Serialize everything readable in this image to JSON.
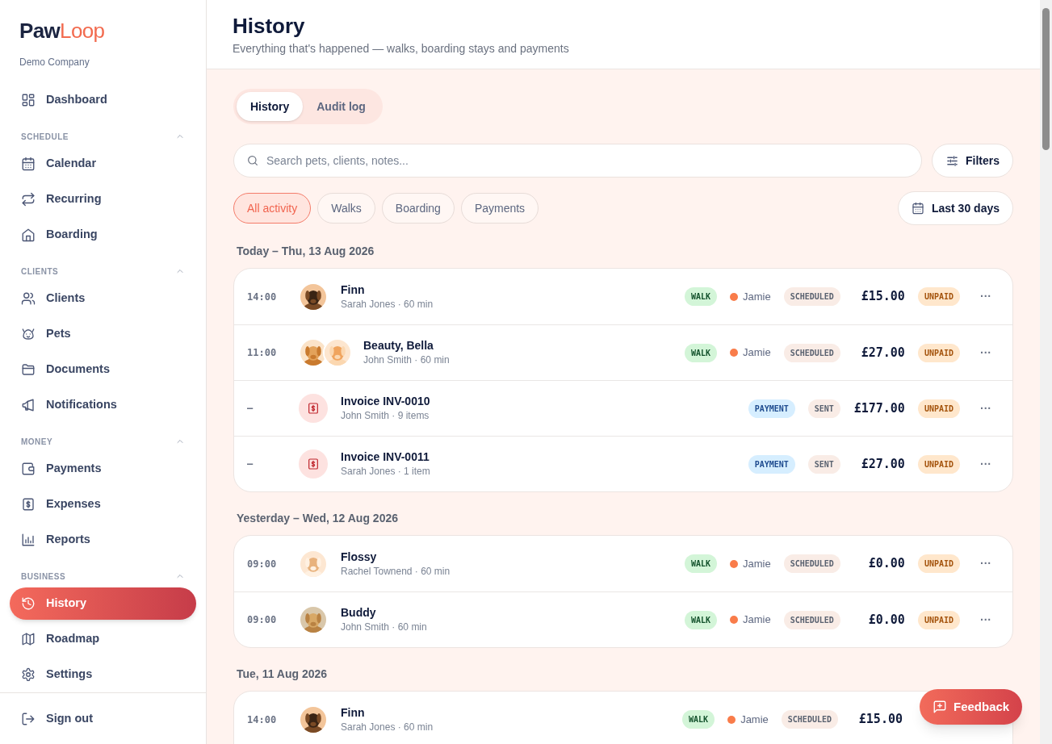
{
  "sidebar": {
    "logo": {
      "lead": "Paw",
      "accent": "Loop"
    },
    "company": "Demo Company",
    "sections": [
      {
        "items": [
          {
            "label": "Dashboard",
            "selected": false
          }
        ]
      },
      {
        "title": "SCHEDULE",
        "expanded": true,
        "items": [
          {
            "label": "Calendar",
            "selected": false
          },
          {
            "label": "Recurring",
            "selected": false
          },
          {
            "label": "Boarding",
            "selected": false
          }
        ]
      },
      {
        "title": "CLIENTS",
        "expanded": true,
        "items": [
          {
            "label": "Clients",
            "selected": false
          },
          {
            "label": "Pets",
            "selected": false
          },
          {
            "label": "Documents",
            "selected": false
          },
          {
            "label": "Notifications",
            "selected": false
          }
        ]
      },
      {
        "title": "MONEY",
        "expanded": true,
        "items": [
          {
            "label": "Payments",
            "selected": false
          },
          {
            "label": "Expenses",
            "selected": false
          },
          {
            "label": "Reports",
            "selected": false
          }
        ]
      },
      {
        "title": "BUSINESS",
        "expanded": true,
        "items": [
          {
            "label": "History",
            "selected": true
          },
          {
            "label": "Roadmap",
            "selected": false
          },
          {
            "label": "Settings",
            "selected": false
          }
        ]
      }
    ],
    "sign_out": "Sign out"
  },
  "header": {
    "title": "History",
    "subtitle": "Everything that's happened — walks, boarding stays and payments"
  },
  "tabs": [
    {
      "label": "History",
      "selected": true
    },
    {
      "label": "Audit log",
      "selected": false
    }
  ],
  "search": {
    "placeholder": "Search pets, clients, notes..."
  },
  "filters_button": "Filters",
  "chips": [
    {
      "label": "All activity",
      "selected": true
    },
    {
      "label": "Walks",
      "selected": false
    },
    {
      "label": "Boarding",
      "selected": false
    },
    {
      "label": "Payments",
      "selected": false
    }
  ],
  "range_button": "Last 30 days",
  "groups": [
    {
      "date": "Today – Thu, 13 Aug 2026",
      "rows": [
        {
          "kind": "visit",
          "time": "14:00",
          "title": "Finn",
          "subtitle": "Sarah Jones · 60 min",
          "type": "WALK",
          "staff": {
            "name": "Jamie",
            "color": "#f97c4a"
          },
          "status": "SCHEDULED",
          "amount": "£15.00",
          "payment": "UNPAID",
          "menu": "···"
        },
        {
          "kind": "visit",
          "time": "11:00",
          "title": "Beauty, Bella",
          "subtitle": "John Smith · 60 min",
          "type": "WALK",
          "staff": {
            "name": "Jamie",
            "color": "#f97c4a"
          },
          "status": "SCHEDULED",
          "amount": "£27.00",
          "payment": "UNPAID",
          "menu": "···"
        },
        {
          "kind": "invoice",
          "time": "–",
          "title": "Invoice INV-0010",
          "subtitle": "John Smith · 9 items",
          "type": "PAYMENT",
          "status": "SENT",
          "amount": "£177.00",
          "payment": "UNPAID",
          "menu": "···"
        },
        {
          "kind": "invoice",
          "time": "–",
          "title": "Invoice INV-0011",
          "subtitle": "Sarah Jones · 1 item",
          "type": "PAYMENT",
          "status": "SENT",
          "amount": "£27.00",
          "payment": "UNPAID",
          "menu": "···"
        }
      ]
    },
    {
      "date": "Yesterday – Wed, 12 Aug 2026",
      "rows": [
        {
          "kind": "visit",
          "time": "09:00",
          "title": "Flossy",
          "subtitle": "Rachel Townend · 60 min",
          "type": "WALK",
          "staff": {
            "name": "Jamie",
            "color": "#f97c4a"
          },
          "status": "SCHEDULED",
          "amount": "£0.00",
          "payment": "UNPAID",
          "menu": "···"
        },
        {
          "kind": "visit",
          "time": "09:00",
          "title": "Buddy",
          "subtitle": "John Smith · 60 min",
          "type": "WALK",
          "staff": {
            "name": "Jamie",
            "color": "#f97c4a"
          },
          "status": "SCHEDULED",
          "amount": "£0.00",
          "payment": "UNPAID",
          "menu": "···"
        }
      ]
    },
    {
      "date": "Tue, 11 Aug 2026",
      "rows": [
        {
          "kind": "visit",
          "time": "14:00",
          "title": "Finn",
          "subtitle": "Sarah Jones · 60 min",
          "type": "WALK",
          "staff": {
            "name": "Jamie",
            "color": "#f97c4a"
          },
          "status": "SCHEDULED",
          "amount": "£15.00"
        }
      ]
    }
  ],
  "feedback_button": "Feedback"
}
